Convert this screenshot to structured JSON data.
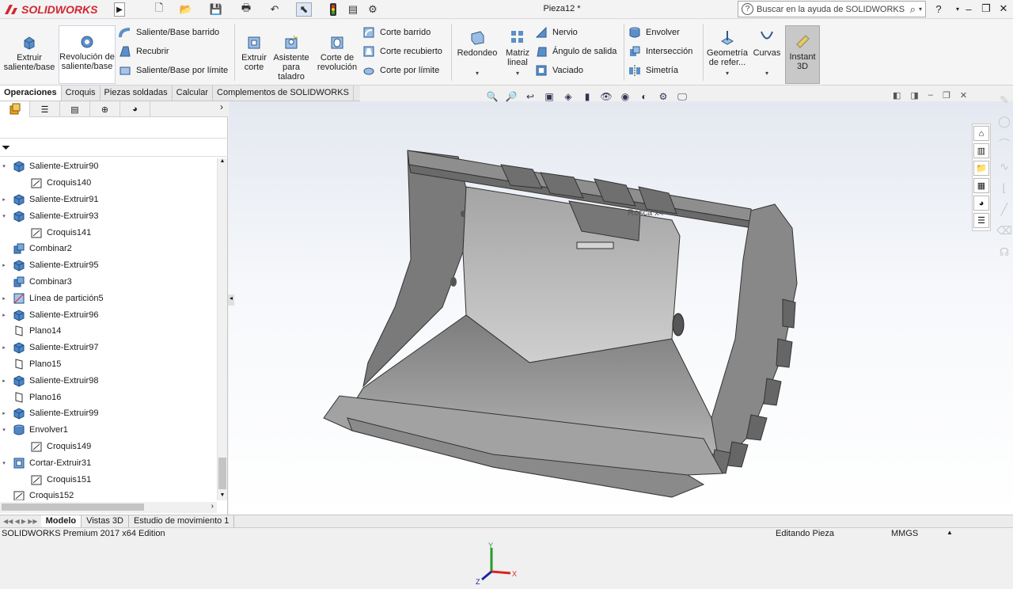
{
  "titlebar": {
    "brand": "SOLIDWORKS",
    "doc_title": "Pieza12 *",
    "search_placeholder": "Buscar en la ayuda de SOLIDWORKS",
    "help": "?",
    "min": "–",
    "restore": "❐",
    "close": "✕"
  },
  "ribbon": {
    "extrude": "Extruir saliente/base",
    "revolve": "Revolución de saliente/base",
    "sweep": "Saliente/Base barrido",
    "loft": "Recubrir",
    "boundary": "Saliente/Base por límite",
    "cut_extrude": "Extruir corte",
    "hole_wizard": "Asistente para taladro",
    "revolve_cut": "Corte de revolución",
    "swept_cut": "Corte barrido",
    "lofted_cut": "Corte recubierto",
    "boundary_cut": "Corte por límite",
    "fillet": "Redondeo",
    "linear_pattern": "Matriz lineal",
    "rib": "Nervio",
    "draft": "Ángulo de salida",
    "shell": "Vaciado",
    "wrap": "Envolver",
    "intersect": "Intersección",
    "mirror": "Simetría",
    "ref_geometry": "Geometría de refer...",
    "curves": "Curvas",
    "instant3d": "Instant 3D"
  },
  "tabs": [
    "Operaciones",
    "Croquis",
    "Piezas soldadas",
    "Calcular",
    "Complementos de SOLIDWORKS"
  ],
  "tree": [
    {
      "label": "Saliente-Extruir90",
      "icon": "extrude-icon",
      "exp": "▾",
      "child": false
    },
    {
      "label": "Croquis140",
      "icon": "sketch-icon",
      "exp": "",
      "child": true
    },
    {
      "label": "Saliente-Extruir91",
      "icon": "extrude-icon",
      "exp": "▸",
      "child": false
    },
    {
      "label": "Saliente-Extruir93",
      "icon": "extrude-icon",
      "exp": "▾",
      "child": false
    },
    {
      "label": "Croquis141",
      "icon": "sketch-icon",
      "exp": "",
      "child": true
    },
    {
      "label": "Combinar2",
      "icon": "combine-icon",
      "exp": "",
      "child": false
    },
    {
      "label": "Saliente-Extruir95",
      "icon": "extrude-icon",
      "exp": "▸",
      "child": false
    },
    {
      "label": "Combinar3",
      "icon": "combine-icon",
      "exp": "",
      "child": false
    },
    {
      "label": "Línea de partición5",
      "icon": "split-line-icon",
      "exp": "▸",
      "child": false
    },
    {
      "label": "Saliente-Extruir96",
      "icon": "extrude-icon",
      "exp": "▸",
      "child": false
    },
    {
      "label": "Plano14",
      "icon": "plane-icon",
      "exp": "",
      "child": false
    },
    {
      "label": "Saliente-Extruir97",
      "icon": "extrude-icon",
      "exp": "▸",
      "child": false
    },
    {
      "label": "Plano15",
      "icon": "plane-icon",
      "exp": "",
      "child": false
    },
    {
      "label": "Saliente-Extruir98",
      "icon": "extrude-icon",
      "exp": "▸",
      "child": false
    },
    {
      "label": "Plano16",
      "icon": "plane-icon",
      "exp": "",
      "child": false
    },
    {
      "label": "Saliente-Extruir99",
      "icon": "extrude-icon",
      "exp": "▸",
      "child": false
    },
    {
      "label": "Envolver1",
      "icon": "wrap-icon",
      "exp": "▾",
      "child": false
    },
    {
      "label": "Croquis149",
      "icon": "sketch-icon",
      "exp": "",
      "child": true
    },
    {
      "label": "Cortar-Extruir31",
      "icon": "cut-extrude-icon",
      "exp": "▾",
      "child": false
    },
    {
      "label": "Croquis151",
      "icon": "sketch-icon",
      "exp": "",
      "child": true
    },
    {
      "label": "Croquis152",
      "icon": "sketch-icon",
      "exp": "",
      "child": false
    }
  ],
  "bottom_tabs": [
    "Modelo",
    "Vistas 3D",
    "Estudio de movimiento 1"
  ],
  "status": {
    "edition": "SOLIDWORKS Premium 2017 x64 Edition",
    "mode": "Editando Pieza",
    "units": "MMGS"
  },
  "model_annotation": "Rosca x4",
  "colors": {
    "brand": "#d22630",
    "accent": "#1d6fb8",
    "model": "#8e8e8e"
  }
}
